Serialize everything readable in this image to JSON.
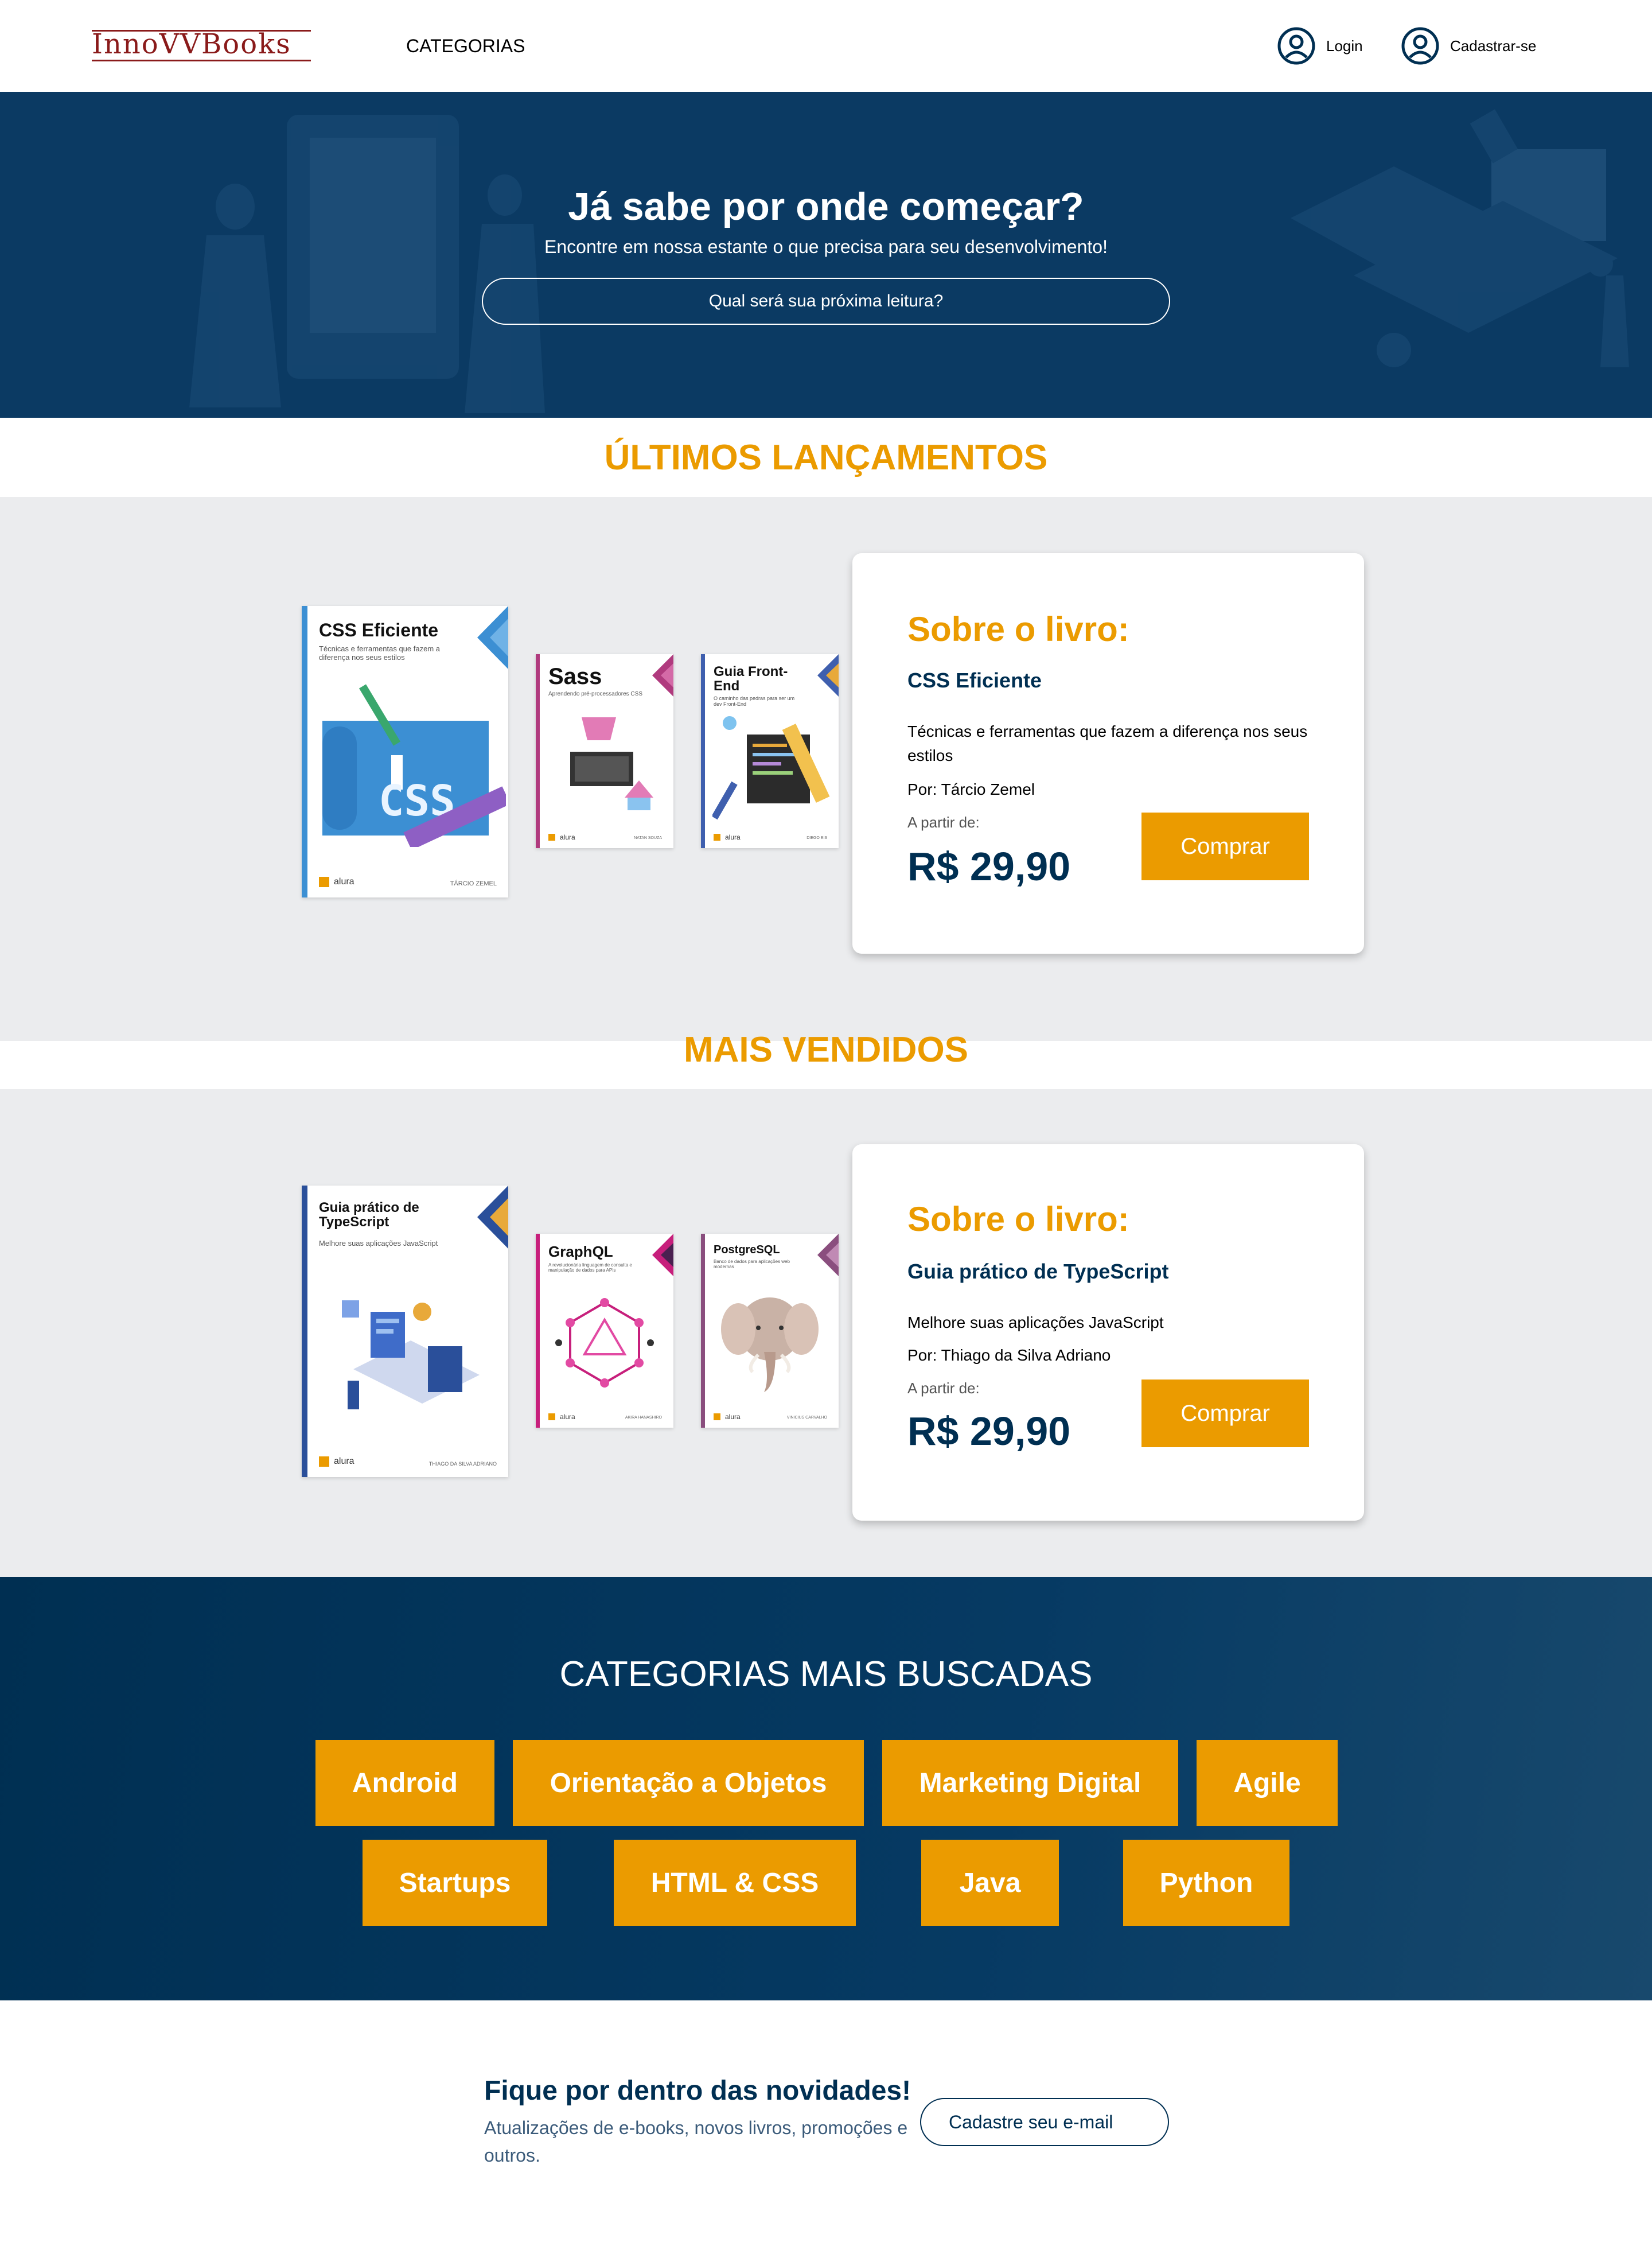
{
  "header": {
    "logo_text": "InnoVVBooks",
    "nav_categories": "CATEGORIAS",
    "login_label": "Login",
    "signup_label": "Cadastrar-se",
    "user_icon": "user-circle-icon"
  },
  "hero": {
    "title": "Já sabe por onde começar?",
    "subtitle": "Encontre em nossa estante o que precisa para seu desenvolvimento!",
    "search_placeholder": "Qual será sua próxima leitura?"
  },
  "releases": {
    "section_title": "ÚLTIMOS LANÇAMENTOS",
    "books": [
      {
        "title": "CSS Eficiente",
        "subtitle": "Técnicas e ferramentas que fazem a diferença nos seus estilos",
        "publisher": "alura",
        "author_tag": "TÁRCIO ZEMEL",
        "accent": "#3c8fd3"
      },
      {
        "title": "Sass",
        "subtitle": "Aprendendo pré-processadores CSS",
        "publisher": "alura",
        "author_tag": "NATAN SOUZA",
        "accent": "#b03a7e"
      },
      {
        "title": "Guia Front-End",
        "subtitle": "O caminho das pedras para ser um dev Front-End",
        "publisher": "alura",
        "author_tag": "DIEGO EIS",
        "accent": "#3f5fae"
      }
    ],
    "card": {
      "about_label": "Sobre o livro:",
      "book_name": "CSS Eficiente",
      "description": "Técnicas e ferramentas que fazem a diferença nos seus estilos",
      "author": "Por: Tárcio Zemel",
      "from_label": "A partir de:",
      "price": "R$ 29,90",
      "buy_label": "Comprar"
    }
  },
  "bestsellers": {
    "section_title": "MAIS VENDIDOS",
    "books": [
      {
        "title": "Guia prático de TypeScript",
        "subtitle": "Melhore suas aplicações JavaScript",
        "publisher": "alura",
        "author_tag": "THIAGO DA SILVA ADRIANO",
        "accent": "#2a4f9a"
      },
      {
        "title": "GraphQL",
        "subtitle": "A revolucionária linguagem de consulta e manipulação de dados para APIs",
        "publisher": "alura",
        "author_tag": "AKIRA HANASHIRO",
        "accent": "#c71f7c"
      },
      {
        "title": "PostgreSQL",
        "subtitle": "Banco de dados para aplicações web modernas",
        "publisher": "alura",
        "author_tag": "VINICIUS CARVALHO",
        "accent": "#8a4e7e"
      }
    ],
    "card": {
      "about_label": "Sobre o livro:",
      "book_name": "Guia prático de TypeScript",
      "description": "Melhore suas aplicações JavaScript",
      "author": "Por: Thiago da Silva Adriano",
      "from_label": "A partir de:",
      "price": "R$ 29,90",
      "buy_label": "Comprar"
    }
  },
  "categories": {
    "title": "CATEGORIAS MAIS BUSCADAS",
    "tags": [
      "Android",
      "Orientação a Objetos",
      "Marketing Digital",
      "Agile",
      "Startups",
      "HTML & CSS",
      "Java",
      "Python"
    ]
  },
  "newsletter": {
    "title": "Fique por dentro das novidades!",
    "text": "Atualizações de e-books, novos livros, promoções e outros.",
    "input_placeholder": "Cadastre seu e-mail"
  },
  "colors": {
    "navy": "#002f52",
    "orange": "#eb9b00",
    "band_gray": "#ebecee"
  }
}
